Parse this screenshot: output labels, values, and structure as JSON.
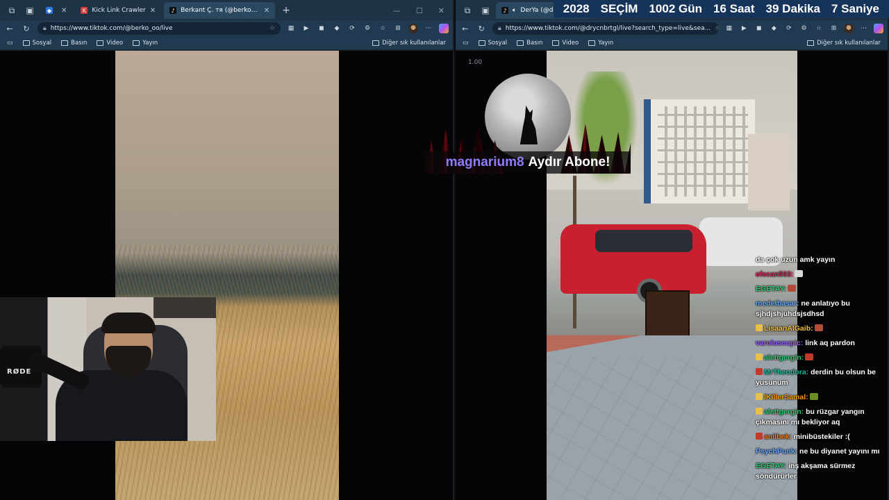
{
  "countdown": {
    "items": [
      "2028",
      "SEÇİM",
      "1002 Gün",
      "16 Saat",
      "39 Dakika",
      "7 Saniye"
    ],
    "bg": "#16335a"
  },
  "left_window": {
    "tabs": [
      {
        "label": "",
        "fav_color": "#2c7be5"
      },
      {
        "label": "Kick Link Crawler",
        "fav_color": "#d43c3c"
      },
      {
        "label": "Berkant Ç. тя (@berko_oo) CANLI",
        "fav_color": "#111111",
        "active": true
      }
    ],
    "url": "https://www.tiktok.com/@berko_oo/live",
    "bookmarks": [
      "Sosyal",
      "Basın",
      "Video",
      "Yayın"
    ],
    "bookmarks_right": "Diğer sık kullanılanlar",
    "webcam_brand": "RØDE"
  },
  "right_window": {
    "tab": {
      "label": "DerYa (@drycnbrtgl)"
    },
    "url": "https://www.tiktok.com/@drycnbrtgl/live?search_type=live&sea...",
    "bookmarks": [
      "Sosyal",
      "Basın",
      "Video",
      "Yayın"
    ],
    "bookmarks_right": "Diğer sık kullanılanlar",
    "zoom": "1.00"
  },
  "overlay": {
    "username": "magnarium8",
    "cta": "Aydır Abone!"
  },
  "chat": [
    {
      "user": "",
      "user_color": "#ffffff",
      "badge": "",
      "text": "da çok uzun amk yayın"
    },
    {
      "user": "efecan563:",
      "user_color": "#e0245e",
      "badge": "",
      "text": "",
      "emote": "#d8d8d8"
    },
    {
      "user": "EGETAY:",
      "user_color": "#2ecc71",
      "badge": "",
      "text": "",
      "emote": "#b24c3a"
    },
    {
      "user": "medetbasar:",
      "user_color": "#5fa8ff",
      "badge": "",
      "text": "ne anlatıyo bu sjhdjshjuhdsjsdhsd"
    },
    {
      "user": "LisaanAlGaib:",
      "user_color": "#f0c040",
      "badge": "#e8c04a",
      "text": "",
      "emote": "#b24c3a"
    },
    {
      "user": "varoluscupic:",
      "user_color": "#9b59ff",
      "badge": "",
      "text": "link aq pardon"
    },
    {
      "user": "alettgergin:",
      "user_color": "#2ecc71",
      "badge": "#e8c04a",
      "text": "",
      "emote": "#c0392b"
    },
    {
      "user": "MrTheodora:",
      "user_color": "#1abc9c",
      "badge": "#c0392b",
      "text": "derdin bu olsun be yusunum"
    },
    {
      "user": "IKillerSamal:",
      "user_color": "#f39c12",
      "badge": "#e8c04a",
      "text": "",
      "emote": "#6b8e23"
    },
    {
      "user": "alettgergin:",
      "user_color": "#2ecc71",
      "badge": "#e8c04a",
      "text": "bu rüzgar yangın çıkmasını mı bekliyor aq"
    },
    {
      "user": "anilbek:",
      "user_color": "#e67e22",
      "badge": "#c0392b",
      "text": "minibüstekiler :("
    },
    {
      "user": "PsychPunk:",
      "user_color": "#5fa8ff",
      "badge": "",
      "text": "ne bu diyanet yayını mı"
    },
    {
      "user": "EGETAY:",
      "user_color": "#2ecc71",
      "badge": "",
      "text": "inş akşama sürmez söndürürler"
    }
  ]
}
